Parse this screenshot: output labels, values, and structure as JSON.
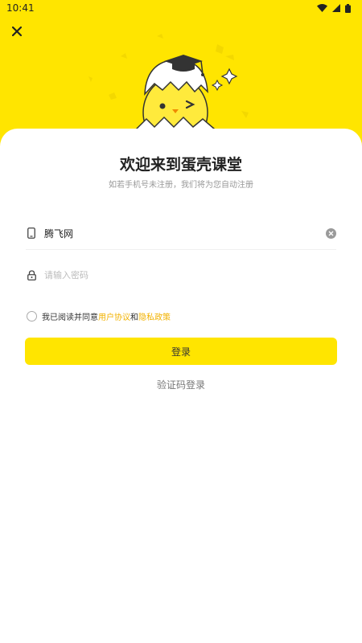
{
  "status_bar": {
    "time": "10:41",
    "icons": [
      "wifi-icon",
      "signal-icon",
      "battery-icon"
    ]
  },
  "header": {
    "close_icon": "close-icon",
    "mascot": "egg-chick-mascot-with-graduation-cap"
  },
  "welcome": {
    "title": "欢迎来到蛋壳课堂",
    "subtitle": "如若手机号未注册，我们将为您自动注册"
  },
  "form": {
    "account": {
      "icon": "phone-icon",
      "value": "腾飞网",
      "clear_icon": "clear-icon"
    },
    "password": {
      "icon": "lock-icon",
      "placeholder": "请输入密码"
    }
  },
  "agreement": {
    "prefix": "我已阅读并同意",
    "user_agreement": "用户协议",
    "and": "和",
    "privacy_policy": "隐私政策"
  },
  "actions": {
    "login_label": "登录",
    "alt_login_label": "验证码登录"
  },
  "colors": {
    "accent": "#FFE500",
    "link": "#F2B200"
  }
}
